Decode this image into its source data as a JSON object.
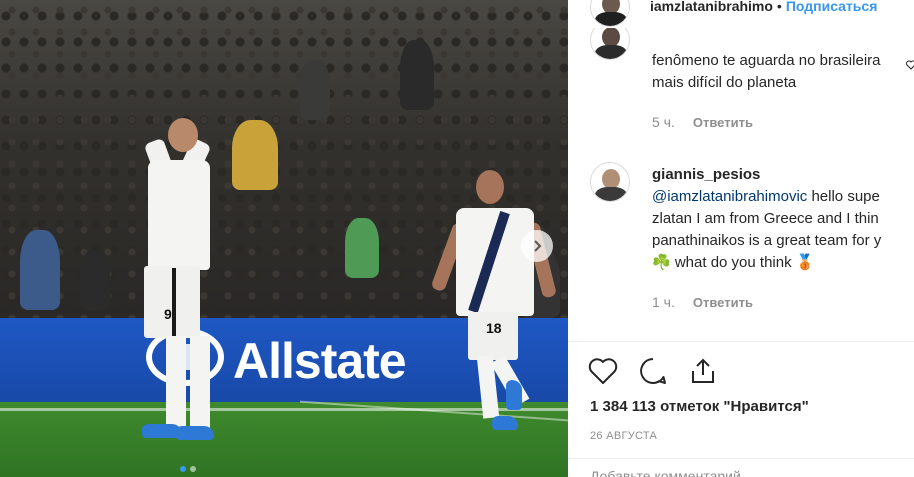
{
  "header": {
    "username": "iamzlatanibrahimo",
    "separator": "•",
    "follow_label": "Подписаться"
  },
  "comments": [
    {
      "lines": [
        "fenômeno te aguarda no brasileira",
        "mais difícil do planeta"
      ],
      "time": "5 ч.",
      "reply_label": "Ответить"
    },
    {
      "username": "giannis_pesios",
      "mention": "@iamzlatanibrahimovic",
      "lines": [
        "hello supe",
        "zlatan I am from Greece and I thin",
        "panathinaikos is a great team for y",
        "☘️ what do you think 🥉"
      ],
      "time": "1 ч.",
      "reply_label": "Ответить"
    }
  ],
  "photo": {
    "board_text": "Allstate",
    "player_left_number": "9",
    "player_right_number": "18",
    "carousel_slides": 2,
    "carousel_active": 1
  },
  "actions": {
    "like_icon": "heart-outline-icon",
    "comment_icon": "comment-bubble-icon",
    "share_icon": "share-upload-icon"
  },
  "likes_text": "1 384 113 отметок \"Нравится\"",
  "date_text": "26 АВГУСТА",
  "add_comment_placeholder": "Добавьте комментарий...",
  "colors": {
    "accent": "#3897f0",
    "secondary_text": "#8e8e8e",
    "mention": "#00376b",
    "board_blue": "#1f58c4"
  }
}
